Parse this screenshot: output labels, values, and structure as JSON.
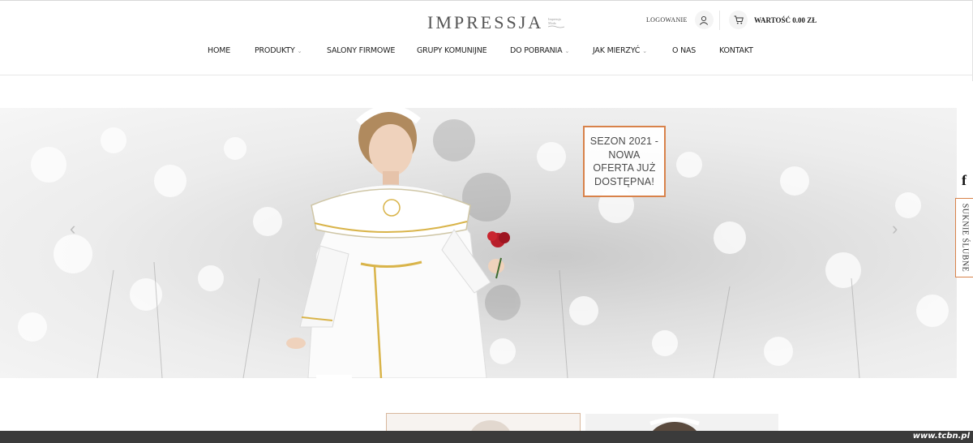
{
  "header": {
    "logo_text": "IMPRESSJA",
    "logo_mark_lines": [
      "Impressja",
      "Moda"
    ],
    "login_label": "LOGOWANIE",
    "cart_label": "WARTOŚĆ 0.00 ZŁ"
  },
  "nav": {
    "items": [
      {
        "label": "HOME",
        "has_dropdown": false
      },
      {
        "label": "PRODUKTY",
        "has_dropdown": true
      },
      {
        "label": "SALONY FIRMOWE",
        "has_dropdown": false
      },
      {
        "label": "GRUPY KOMUNIJNE",
        "has_dropdown": false
      },
      {
        "label": "DO POBRANIA",
        "has_dropdown": true
      },
      {
        "label": "JAK MIERZYĆ",
        "has_dropdown": true
      },
      {
        "label": "O NAS",
        "has_dropdown": false
      },
      {
        "label": "KONTAKT",
        "has_dropdown": false
      }
    ],
    "caret": "⌄"
  },
  "hero": {
    "promo_text": "SEZON 2021 - NOWA OFERTA JUŻ DOSTĘPNA!",
    "prev_arrow": "‹",
    "next_arrow": "›",
    "accent_color": "#d8824a"
  },
  "side": {
    "facebook_label": "f",
    "tab_label": "SUKNIE ŚLUBNE"
  },
  "watermark": "www.tcbn.pl",
  "icons": {
    "login": "user-icon",
    "cart": "cart-icon",
    "facebook": "facebook-icon"
  }
}
